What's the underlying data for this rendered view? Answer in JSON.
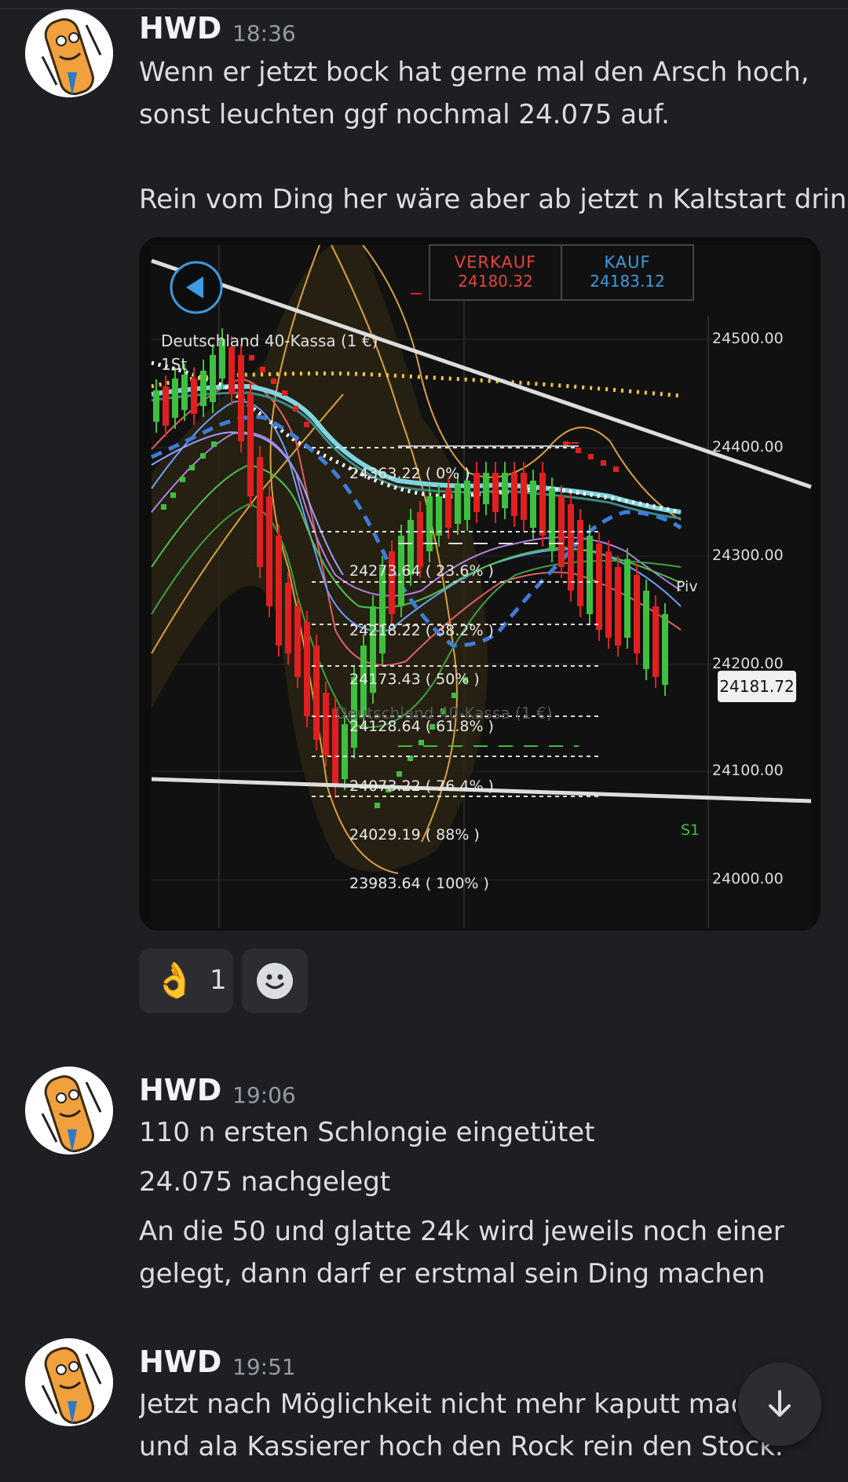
{
  "messages": [
    {
      "author": "HWD",
      "time": "18:36",
      "lines": [
        "Wenn er jetzt bock hat gerne mal den Arsch hoch,",
        "sonst leuchten ggf nochmal 24.075 auf.",
        "Rein vom Ding her wäre aber ab jetzt n Kaltstart drin."
      ]
    },
    {
      "author": "HWD",
      "time": "19:06",
      "lines": [
        "110 n ersten Schlongie eingetütet",
        "24.075 nachgelegt",
        "An die 50 und glatte 24k wird jeweils noch einer",
        "gelegt, dann darf er erstmal sein Ding machen"
      ]
    },
    {
      "author": "HWD",
      "time": "19:51",
      "lines": [
        "Jetzt nach Möglichkeit nicht mehr kaputt mach",
        "und ala Kassierer hoch den Rock rein den Stock."
      ]
    }
  ],
  "chart": {
    "sell_label": "VERKAUF",
    "sell_price": "24180.32",
    "buy_label": "KAUF",
    "buy_price": "24183.12",
    "instrument": "Deutschland 40-Kassa (1 €)",
    "timeframe": "1St",
    "watermark": "Deutschland 40-Kassa (1 €)",
    "current_price": "24181.72",
    "pivot_label": "Piv",
    "support_label": "S1",
    "y_ticks": [
      "24500.00",
      "24400.00",
      "24300.00",
      "24200.00",
      "24100.00",
      "24000.00"
    ],
    "fib_levels": [
      "24363.22 ( 0% )",
      "24273.64 ( 23.6% )",
      "24218.22 ( 38.2% )",
      "24173.43 ( 50% )",
      "24128.64 ( 61.8% )",
      "24073.22 ( 76.4% )",
      "24029.19 ( 88% )",
      "23983.64 ( 100% )"
    ],
    "colors": {
      "sell": "#e0463e",
      "buy": "#3d9be0",
      "up_candle": "#3fbf3f",
      "down_candle": "#e02020",
      "ribbon": "#7fd4e0",
      "dotted_ma": "#f5c542"
    }
  },
  "reactions": [
    {
      "emoji": "👌",
      "count": "1"
    }
  ]
}
